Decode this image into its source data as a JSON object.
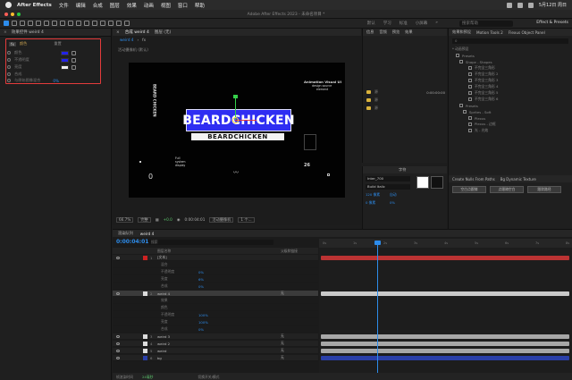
{
  "menubar": {
    "app_name": "After Effects",
    "items": [
      "文件",
      "编辑",
      "合成",
      "图层",
      "效果",
      "动画",
      "视图",
      "窗口",
      "帮助"
    ],
    "datetime": "5月12日 周日"
  },
  "window": {
    "title": "Adobe After Effects 2023 - 未命名项目 *"
  },
  "toolbar": {
    "workspaces": [
      "默认",
      "学习",
      "标准",
      "小屏幕"
    ],
    "workspace_menu": "»",
    "search_placeholder": "搜索帮助",
    "right_label": "Effect & Presets"
  },
  "effect_controls": {
    "tab_label": "效果控件 weird 4",
    "header_fx": "fx",
    "header_name": "颜色",
    "header_reset": "重置",
    "props": [
      "颜色",
      "不透明度",
      "亮度",
      "合成",
      "与原始图像混合"
    ],
    "extra_value": "0%",
    "colors": {
      "swatch_blue": "#2323e8",
      "swatch_white": "#f0f0f0"
    }
  },
  "composition": {
    "tab_label": "合成 weird 4",
    "tab_label2": "图层 (无)",
    "breadcrumb": [
      "weird 4",
      "fx"
    ],
    "viewer_label": "活动摄像机 (默认)",
    "canvas": {
      "logo_text": "BEARDCHICKEN",
      "sub_text": "BEARDCHICKEN",
      "left_vertical": "BEARD CHICKEN",
      "right_title": "Animation Visual UI",
      "right_sub1": "design source",
      "right_sub2": "element",
      "small_left": "Full",
      "small_left2": "system",
      "small_left3": "display",
      "num_left": "0",
      "num_right": "26",
      "squiggle": "〰"
    },
    "controls": {
      "zoom": "66.7%",
      "quality": "完整",
      "time": "0:00:04:01",
      "camera": "活动摄像机",
      "views": "1 个...",
      "offset": "+0.0"
    }
  },
  "mid_panel": {
    "tabs": [
      "信息",
      "音频",
      "预览",
      "效果"
    ],
    "rows": [
      "源",
      "源",
      "源"
    ],
    "values": [
      "0:00:00:00",
      "",
      ""
    ]
  },
  "effects_presets": {
    "tab": "效果和预设",
    "tab2": "Motion Tools 2",
    "tab3": "Flexus Object Panel",
    "search": "0",
    "tree": [
      "* 动画预设",
      "Presets",
      "Shape - Shapes",
      "不完全三角形",
      "不完全三角形 2",
      "不完全三角形 3",
      "不完全三角形 4",
      "不完全三角形 5",
      "不完全三角形 6",
      "Presets",
      "Sprites - Soft",
      "Plexus",
      "Plexus - 边框",
      "光 - 光效"
    ]
  },
  "motion_tools": {
    "label1": "Inter_700",
    "label2": "Build Italic",
    "label3": "120 像素",
    "label4": "自动",
    "label5": "0 像素",
    "label6": "0%",
    "tab_character": "字符"
  },
  "create_nulls": {
    "tab": "Create Nulls From Paths",
    "tab2": "Bg Dynamic Texture",
    "btn1": "空白点跟随",
    "btn2": "点跟随空白",
    "btn3": "跟踪路径"
  },
  "timeline": {
    "tabs": [
      "渲染队列",
      "weird 4"
    ],
    "current_time": "0:00:04:01",
    "search_placeholder": "搜索",
    "col_header": "图层名称",
    "parent_header": "父级和链接",
    "layers": [
      {
        "num": "1",
        "name": "[文本]",
        "label": "#c22",
        "kind": "layer",
        "bar": "#b33"
      },
      {
        "num": "",
        "name": "",
        "prop": "混合",
        "val": "",
        "kind": "prop",
        "bar": "none"
      },
      {
        "num": "",
        "name": "",
        "prop": "不透明度",
        "val": "0%",
        "kind": "prop",
        "bar": "none"
      },
      {
        "num": "",
        "name": "",
        "prop": "亮度",
        "val": "6%",
        "kind": "prop",
        "bar": "none"
      },
      {
        "num": "",
        "name": "",
        "prop": "合成",
        "val": "0%",
        "kind": "prop",
        "bar": "none"
      },
      {
        "num": "2",
        "name": "weird 4",
        "label": "#ddd",
        "kind": "sel",
        "bar": "#c9c9c9",
        "parent": "无"
      },
      {
        "num": "",
        "name": "",
        "prop": "效果",
        "val": "",
        "kind": "prop",
        "bar": "none"
      },
      {
        "num": "",
        "name": "",
        "prop": "颜色",
        "val": "",
        "kind": "prop",
        "bar": "none"
      },
      {
        "num": "",
        "name": "",
        "prop": "不透明度",
        "val": "100%",
        "kind": "prop",
        "bar": "none"
      },
      {
        "num": "",
        "name": "",
        "prop": "亮度",
        "val": "100%",
        "kind": "prop",
        "bar": "none"
      },
      {
        "num": "",
        "name": "",
        "prop": "合成",
        "val": "0%",
        "kind": "prop",
        "bar": "none"
      },
      {
        "num": "3",
        "name": "weird 3",
        "label": "#ddd",
        "kind": "layer",
        "bar": "#a7a7a7",
        "parent": "无"
      },
      {
        "num": "4",
        "name": "weird 2",
        "label": "#ddd",
        "kind": "layer",
        "bar": "#a7a7a7",
        "parent": "无"
      },
      {
        "num": "5",
        "name": "weird",
        "label": "#ddd",
        "kind": "layer",
        "bar": "#a7a7a7",
        "parent": "无"
      },
      {
        "num": "6",
        "name": "bg",
        "label": "#2a3fa8",
        "kind": "layer",
        "bar": "#2a3fa8",
        "parent": "无"
      }
    ],
    "ticks": [
      "0s",
      "1s",
      "2s",
      "3s",
      "4s",
      "5s",
      "6s",
      "7s",
      "8s"
    ],
    "footer_left": "帧渲染时间",
    "footer_value": "24毫秒",
    "footer_mid": "切换开关/模式"
  }
}
